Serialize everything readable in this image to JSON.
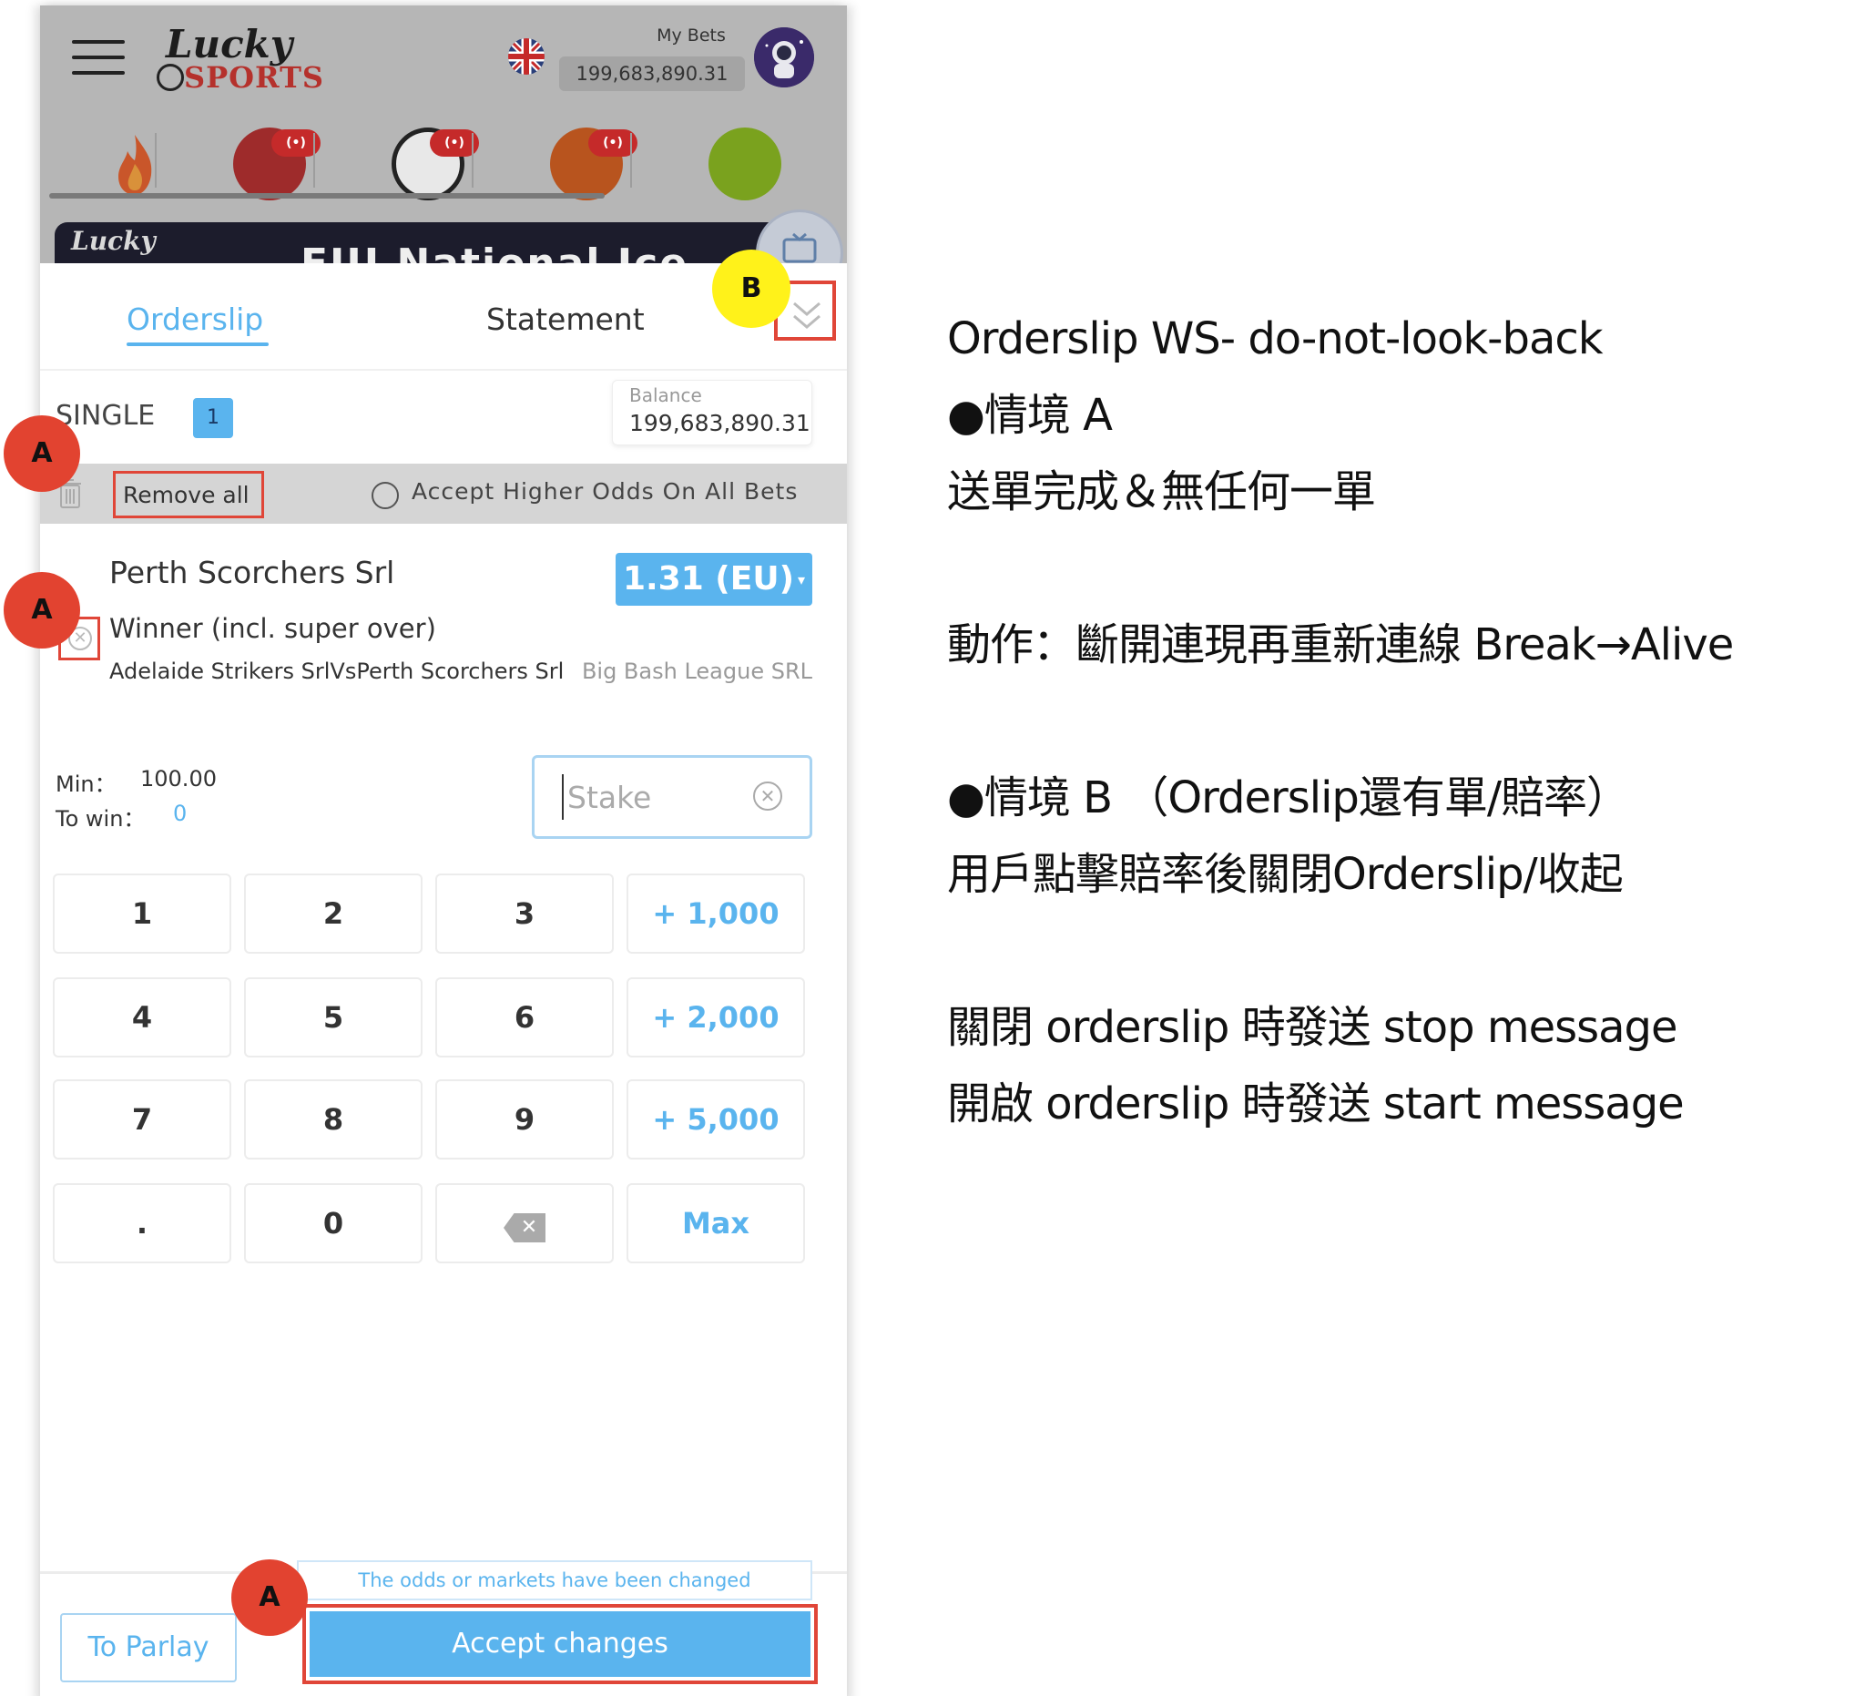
{
  "header": {
    "brand_top": "Lucky",
    "brand_bottom": "SPORTS",
    "flag_icon": "uk-flag-icon",
    "my_bets_label": "My Bets",
    "my_bets_balance": "199,683,890.31",
    "avatar_icon": "astronaut-avatar-icon"
  },
  "sports_bar": {
    "items": [
      {
        "icon": "fire-icon",
        "live": false
      },
      {
        "icon": "cricket-ball-icon",
        "live": true
      },
      {
        "icon": "soccer-ball-icon",
        "live": true
      },
      {
        "icon": "basketball-icon",
        "live": true
      },
      {
        "icon": "tennis-ball-icon",
        "live": false
      }
    ],
    "live_badge": "(•)"
  },
  "banner": {
    "logo": "Lucky",
    "text": "EIU National Ice"
  },
  "tabs": {
    "orderslip": "Orderslip",
    "statement": "Statement",
    "active": "orderslip"
  },
  "slip": {
    "mode_label": "SINGLE",
    "count": "1",
    "balance_label": "Balance",
    "balance_value": "199,683,890.31",
    "remove_all": "Remove all",
    "accept_higher_odds": "Accept Higher Odds On All Bets",
    "bet": {
      "selection": "Perth Scorchers Srl",
      "odds": "1.31 (EU)",
      "market": "Winner (incl. super over)",
      "event": "Adelaide Strikers SrlVsPerth Scorchers Srl",
      "league": "Big Bash League SRL"
    },
    "min_label": "Min：",
    "min_value": "100.00",
    "to_win_label": "To win：",
    "to_win_value": "0",
    "stake_placeholder": "Stake"
  },
  "keypad": {
    "keys": [
      "1",
      "2",
      "3",
      "+ 1,000",
      "4",
      "5",
      "6",
      "+ 2,000",
      "7",
      "8",
      "9",
      "+ 5,000",
      ".",
      "0",
      "⌫",
      "Max"
    ]
  },
  "footer": {
    "notice": "The odds or markets have been changed",
    "to_parlay": "To Parlay",
    "accept_changes": "Accept changes"
  },
  "markers": {
    "a": "A",
    "b": "B"
  },
  "notes": [
    "Orderslip WS- do-not-look-back",
    "●情境 A",
    "送單完成＆無任何一單",
    "",
    "動作：斷開連現再重新連線 Break→Alive",
    "",
    "●情境 B （Orderslip還有單/賠率）",
    "用戶點擊賠率後關閉Orderslip/收起",
    "",
    "關閉 orderslip 時發送 stop message",
    "開啟 orderslip 時發送 start message"
  ],
  "colors": {
    "accent": "#5ab4ee",
    "highlight_red": "#e04638",
    "marker_red": "#e24330",
    "marker_yellow": "#fff21a",
    "overlay_grey": "#b6b6b6"
  }
}
